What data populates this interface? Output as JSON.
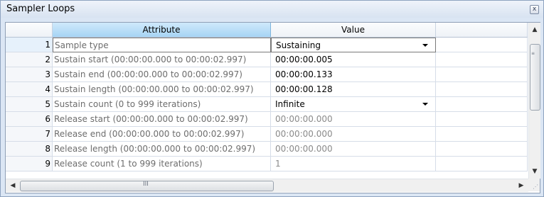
{
  "window": {
    "title": "Sampler Loops",
    "close_symbol": "x"
  },
  "table": {
    "columns": [
      "",
      "Attribute",
      "Value",
      ""
    ],
    "rows": [
      {
        "num": "1",
        "attribute": "Sample type",
        "value": "Sustaining",
        "dropdown": true,
        "muted": false
      },
      {
        "num": "2",
        "attribute": "Sustain start (00:00:00.000 to 00:00:02.997)",
        "value": "00:00:00.005",
        "dropdown": false,
        "muted": false
      },
      {
        "num": "3",
        "attribute": "Sustain end (00:00:00.000 to 00:00:02.997)",
        "value": "00:00:00.133",
        "dropdown": false,
        "muted": false
      },
      {
        "num": "4",
        "attribute": "Sustain length (00:00:00.000 to 00:00:02.997)",
        "value": "00:00:00.128",
        "dropdown": false,
        "muted": false
      },
      {
        "num": "5",
        "attribute": "Sustain count (0 to 999 iterations)",
        "value": "Infinite",
        "dropdown": true,
        "muted": false
      },
      {
        "num": "6",
        "attribute": "Release start (00:00:00.000 to 00:00:02.997)",
        "value": "00:00:00.000",
        "dropdown": false,
        "muted": true
      },
      {
        "num": "7",
        "attribute": "Release end (00:00:00.000 to 00:00:02.997)",
        "value": "00:00:00.000",
        "dropdown": false,
        "muted": true
      },
      {
        "num": "8",
        "attribute": "Release length (00:00:00.000 to 00:00:02.997)",
        "value": "00:00:00.000",
        "dropdown": false,
        "muted": true
      },
      {
        "num": "9",
        "attribute": "Release count (1 to 999 iterations)",
        "value": "1",
        "dropdown": false,
        "muted": true
      }
    ]
  },
  "scroll": {
    "vertical_up": "▲",
    "vertical_down": "▼",
    "horizontal_left": "◀",
    "horizontal_right": "▶",
    "h_grip": "III"
  }
}
